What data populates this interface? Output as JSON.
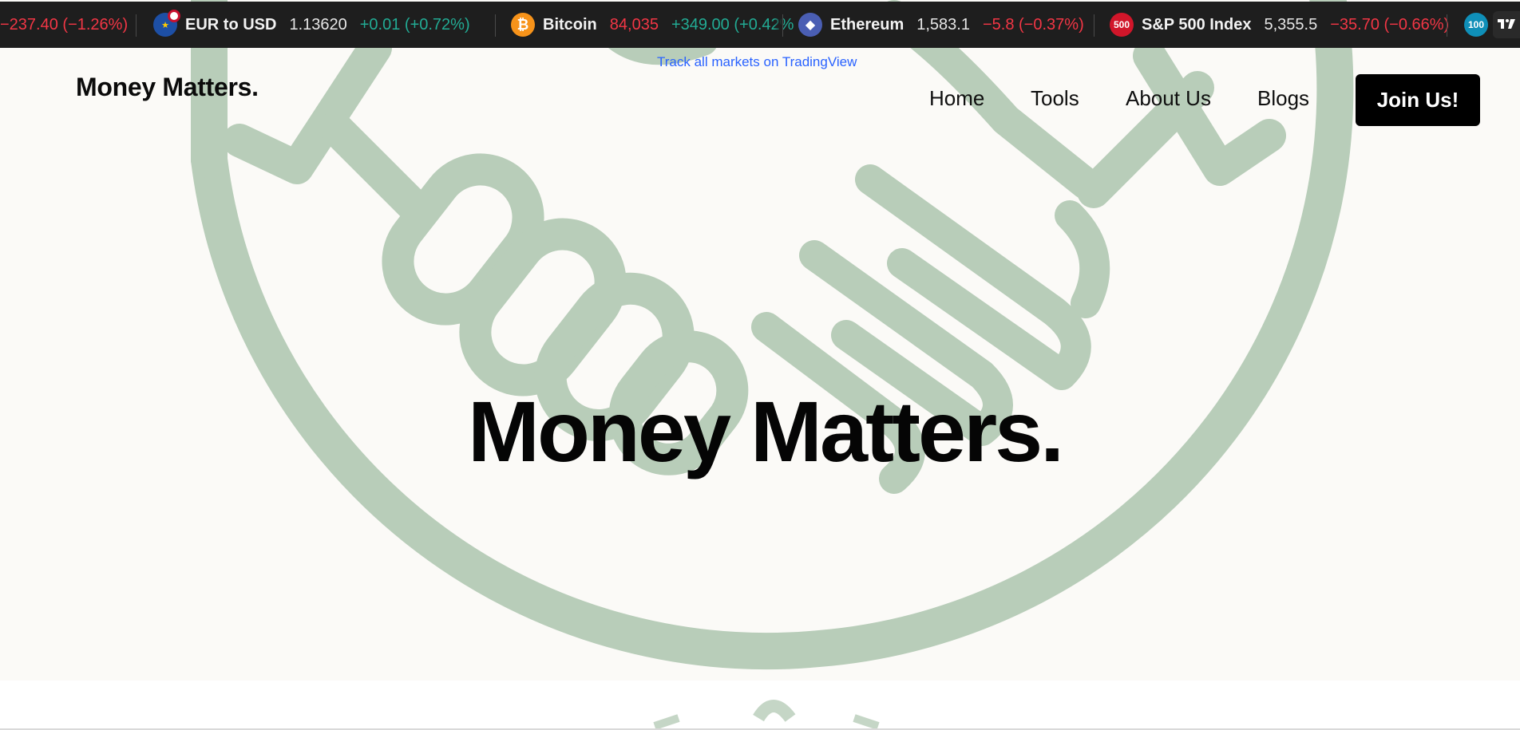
{
  "ticker": {
    "items": [
      {
        "name": "",
        "price": "",
        "change": "−237.40 (−1.26%)",
        "direction": "down"
      },
      {
        "name": "EUR to USD",
        "price": "1.13620",
        "change": "+0.01 (+0.72%)",
        "direction": "up",
        "icon": "eu-us-flag-icon"
      },
      {
        "name": "Bitcoin",
        "price": "84,035",
        "change": "+349.00 (+0.42%",
        "direction": "up",
        "icon": "bitcoin-icon",
        "icon_glyph": "₿",
        "icon_color": "#f7931a"
      },
      {
        "name": "Ethereum",
        "price": "1,583.1",
        "change": "−5.8 (−0.37%)",
        "direction": "down",
        "icon": "ethereum-icon",
        "icon_glyph": "◆",
        "icon_color": "#627eea"
      },
      {
        "name": "S&P 500 Index",
        "price": "5,355.5",
        "change": "−35.70 (−0.66%)",
        "direction": "down",
        "icon": "sp500-icon",
        "icon_glyph": "500",
        "icon_color": "#d1162a"
      },
      {
        "name": "",
        "price": "",
        "change": "",
        "direction": "",
        "icon": "nasdaq100-icon",
        "icon_glyph": "100",
        "icon_color": "#0f8fb8"
      }
    ],
    "attribution": "Track all markets on TradingView",
    "logo_text": "TV",
    "up_color": "#22ab94",
    "down_color": "#f23645"
  },
  "header": {
    "brand": "Money Matters.",
    "nav": [
      "Home",
      "Tools",
      "About Us",
      "Blogs"
    ],
    "cta": "Join Us!"
  },
  "hero": {
    "title": "Money Matters.",
    "watermark_icon": "handshake-icon",
    "watermark_color": "#b8cdb9"
  }
}
